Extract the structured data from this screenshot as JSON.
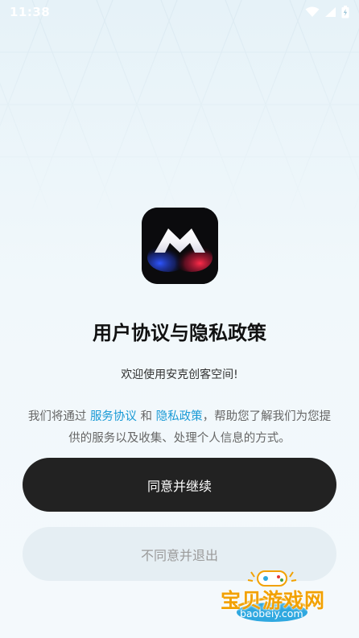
{
  "status_bar": {
    "time": "11:38"
  },
  "dialog": {
    "title": "用户协议与隐私政策",
    "welcome": "欢迎使用安克创客空间!",
    "agreement_prefix": "我们将通过",
    "service_agreement_link": "服务协议",
    "and": "和",
    "privacy_policy_link": "隐私政策",
    "agreement_suffix": "，帮助您了解我们为您提供的服务以及收集、处理个人信息的方式。"
  },
  "buttons": {
    "agree_label": "同意并继续",
    "disagree_label": "不同意并退出"
  },
  "watermark": {
    "text": "宝贝游戏网",
    "url": "baobeiy.com"
  },
  "colors": {
    "link": "#1a9ad6",
    "primary_button": "#222222",
    "secondary_button": "#e5eef3",
    "watermark": "#f2a100"
  },
  "icons": [
    "wifi-icon",
    "signal-icon",
    "battery-charging-icon",
    "app-logo-icon",
    "gamepad-icon"
  ]
}
